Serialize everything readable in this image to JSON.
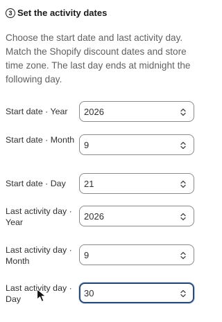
{
  "section": {
    "step_number": "3",
    "title": "Set the activity dates",
    "description": "Choose the start date and last activity day. Match the Shopify discount dates and store time zone. The last day ends at midnight the following day."
  },
  "fields": [
    {
      "label": "Start date · Year",
      "value": "2026"
    },
    {
      "label": "Start date · Month",
      "value": "9"
    },
    {
      "label": "Start date · Day",
      "value": "21"
    },
    {
      "label": "Last activity day · Year",
      "value": "2026"
    },
    {
      "label": "Last activity day · Month",
      "value": "9"
    },
    {
      "label": "Last activity day · Day",
      "value": "30",
      "focused": true
    }
  ],
  "icons": {
    "step": "circled-number-icon",
    "select_arrow": "chevron-up-down-icon",
    "cursor": "mouse-pointer-icon"
  },
  "colors": {
    "focus_border": "#2c4a72",
    "text_muted": "#616161",
    "border": "#8a8a8a"
  }
}
